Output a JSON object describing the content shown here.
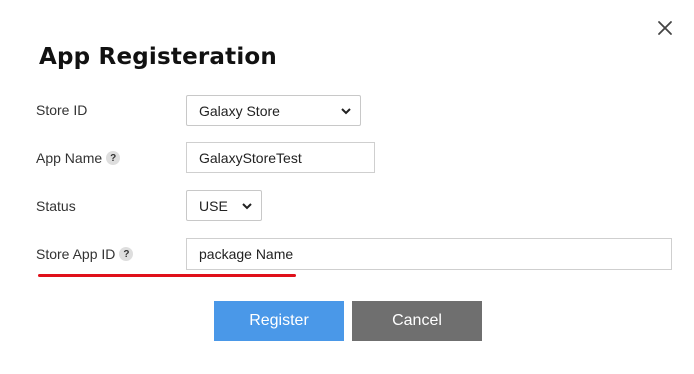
{
  "dialog": {
    "title": "App Registeration",
    "close_icon": "close-icon"
  },
  "form": {
    "store_id": {
      "label": "Store ID",
      "value": "Galaxy Store"
    },
    "app_name": {
      "label": "App Name",
      "help": "?",
      "value": "GalaxyStoreTest"
    },
    "status": {
      "label": "Status",
      "value": "USE"
    },
    "store_app_id": {
      "label": "Store App ID",
      "help": "?",
      "value": "package Name"
    }
  },
  "buttons": {
    "register": "Register",
    "cancel": "Cancel"
  },
  "colors": {
    "register_bg": "#4a98e8",
    "cancel_bg": "#6f6f6f",
    "highlight_underline": "#e0101a"
  }
}
